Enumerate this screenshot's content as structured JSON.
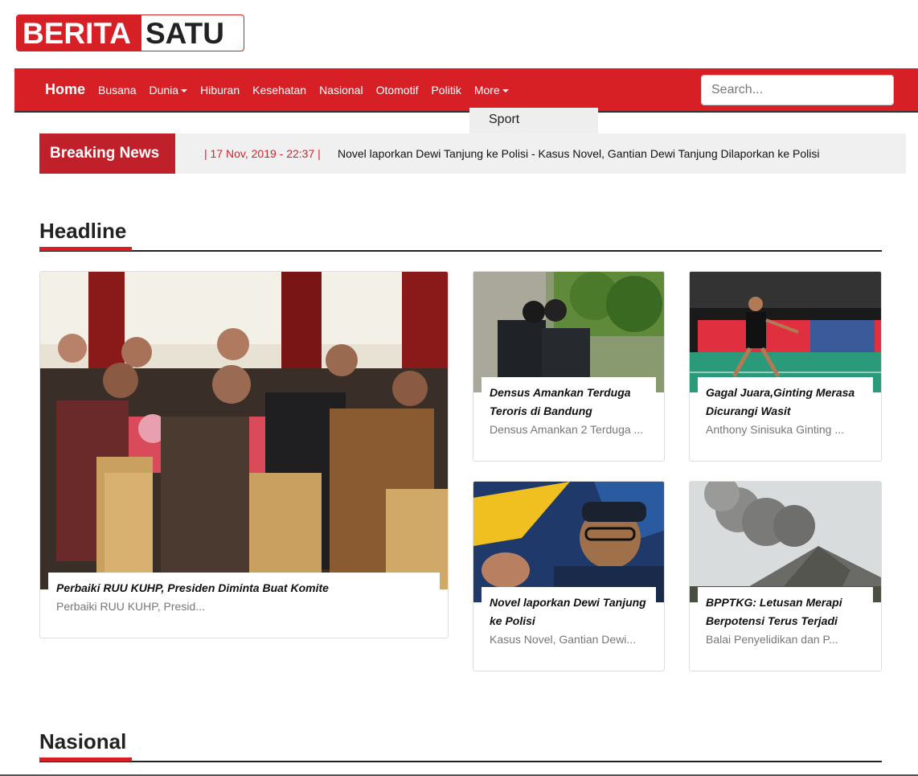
{
  "logo": {
    "part1": "BERITA",
    "part2": "SATU"
  },
  "nav": {
    "items": [
      "Home",
      "Busana",
      "Dunia",
      "Hiburan",
      "Kesehatan",
      "Nasional",
      "Otomotif",
      "Politik",
      "More"
    ],
    "search_placeholder": "Search...",
    "dropdown_item": "Sport"
  },
  "breaking": {
    "label": "Breaking News",
    "date": "| 17 Nov, 2019 - 22:37 |",
    "text": "Novel laporkan Dewi Tanjung ke Polisi - Kasus Novel, Gantian Dewi Tanjung Dilaporkan ke Polisi"
  },
  "sections": {
    "headline": "Headline",
    "nasional": "Nasional"
  },
  "cards": [
    {
      "title": "Perbaiki RUU KUHP, Presiden Diminta Buat Komite",
      "excerpt": "Perbaiki RUU KUHP, Presid..."
    },
    {
      "title": "Densus Amankan Terduga Teroris di Bandung",
      "excerpt": "Densus Amankan 2 Terduga ..."
    },
    {
      "title": "Gagal Juara,Ginting Merasa Dicurangi Wasit",
      "excerpt": "Anthony Sinisuka Ginting ..."
    },
    {
      "title": "Novel laporkan Dewi Tanjung ke Polisi",
      "excerpt": "Kasus Novel, Gantian Dewi..."
    },
    {
      "title": "BPPTKG: Letusan Merapi Berpotensi Terus Terjadi",
      "excerpt": "Balai Penyelidikan dan P..."
    }
  ],
  "colors": {
    "brand_red": "#d71f26",
    "breaking_bg": "#f0f0f0"
  }
}
